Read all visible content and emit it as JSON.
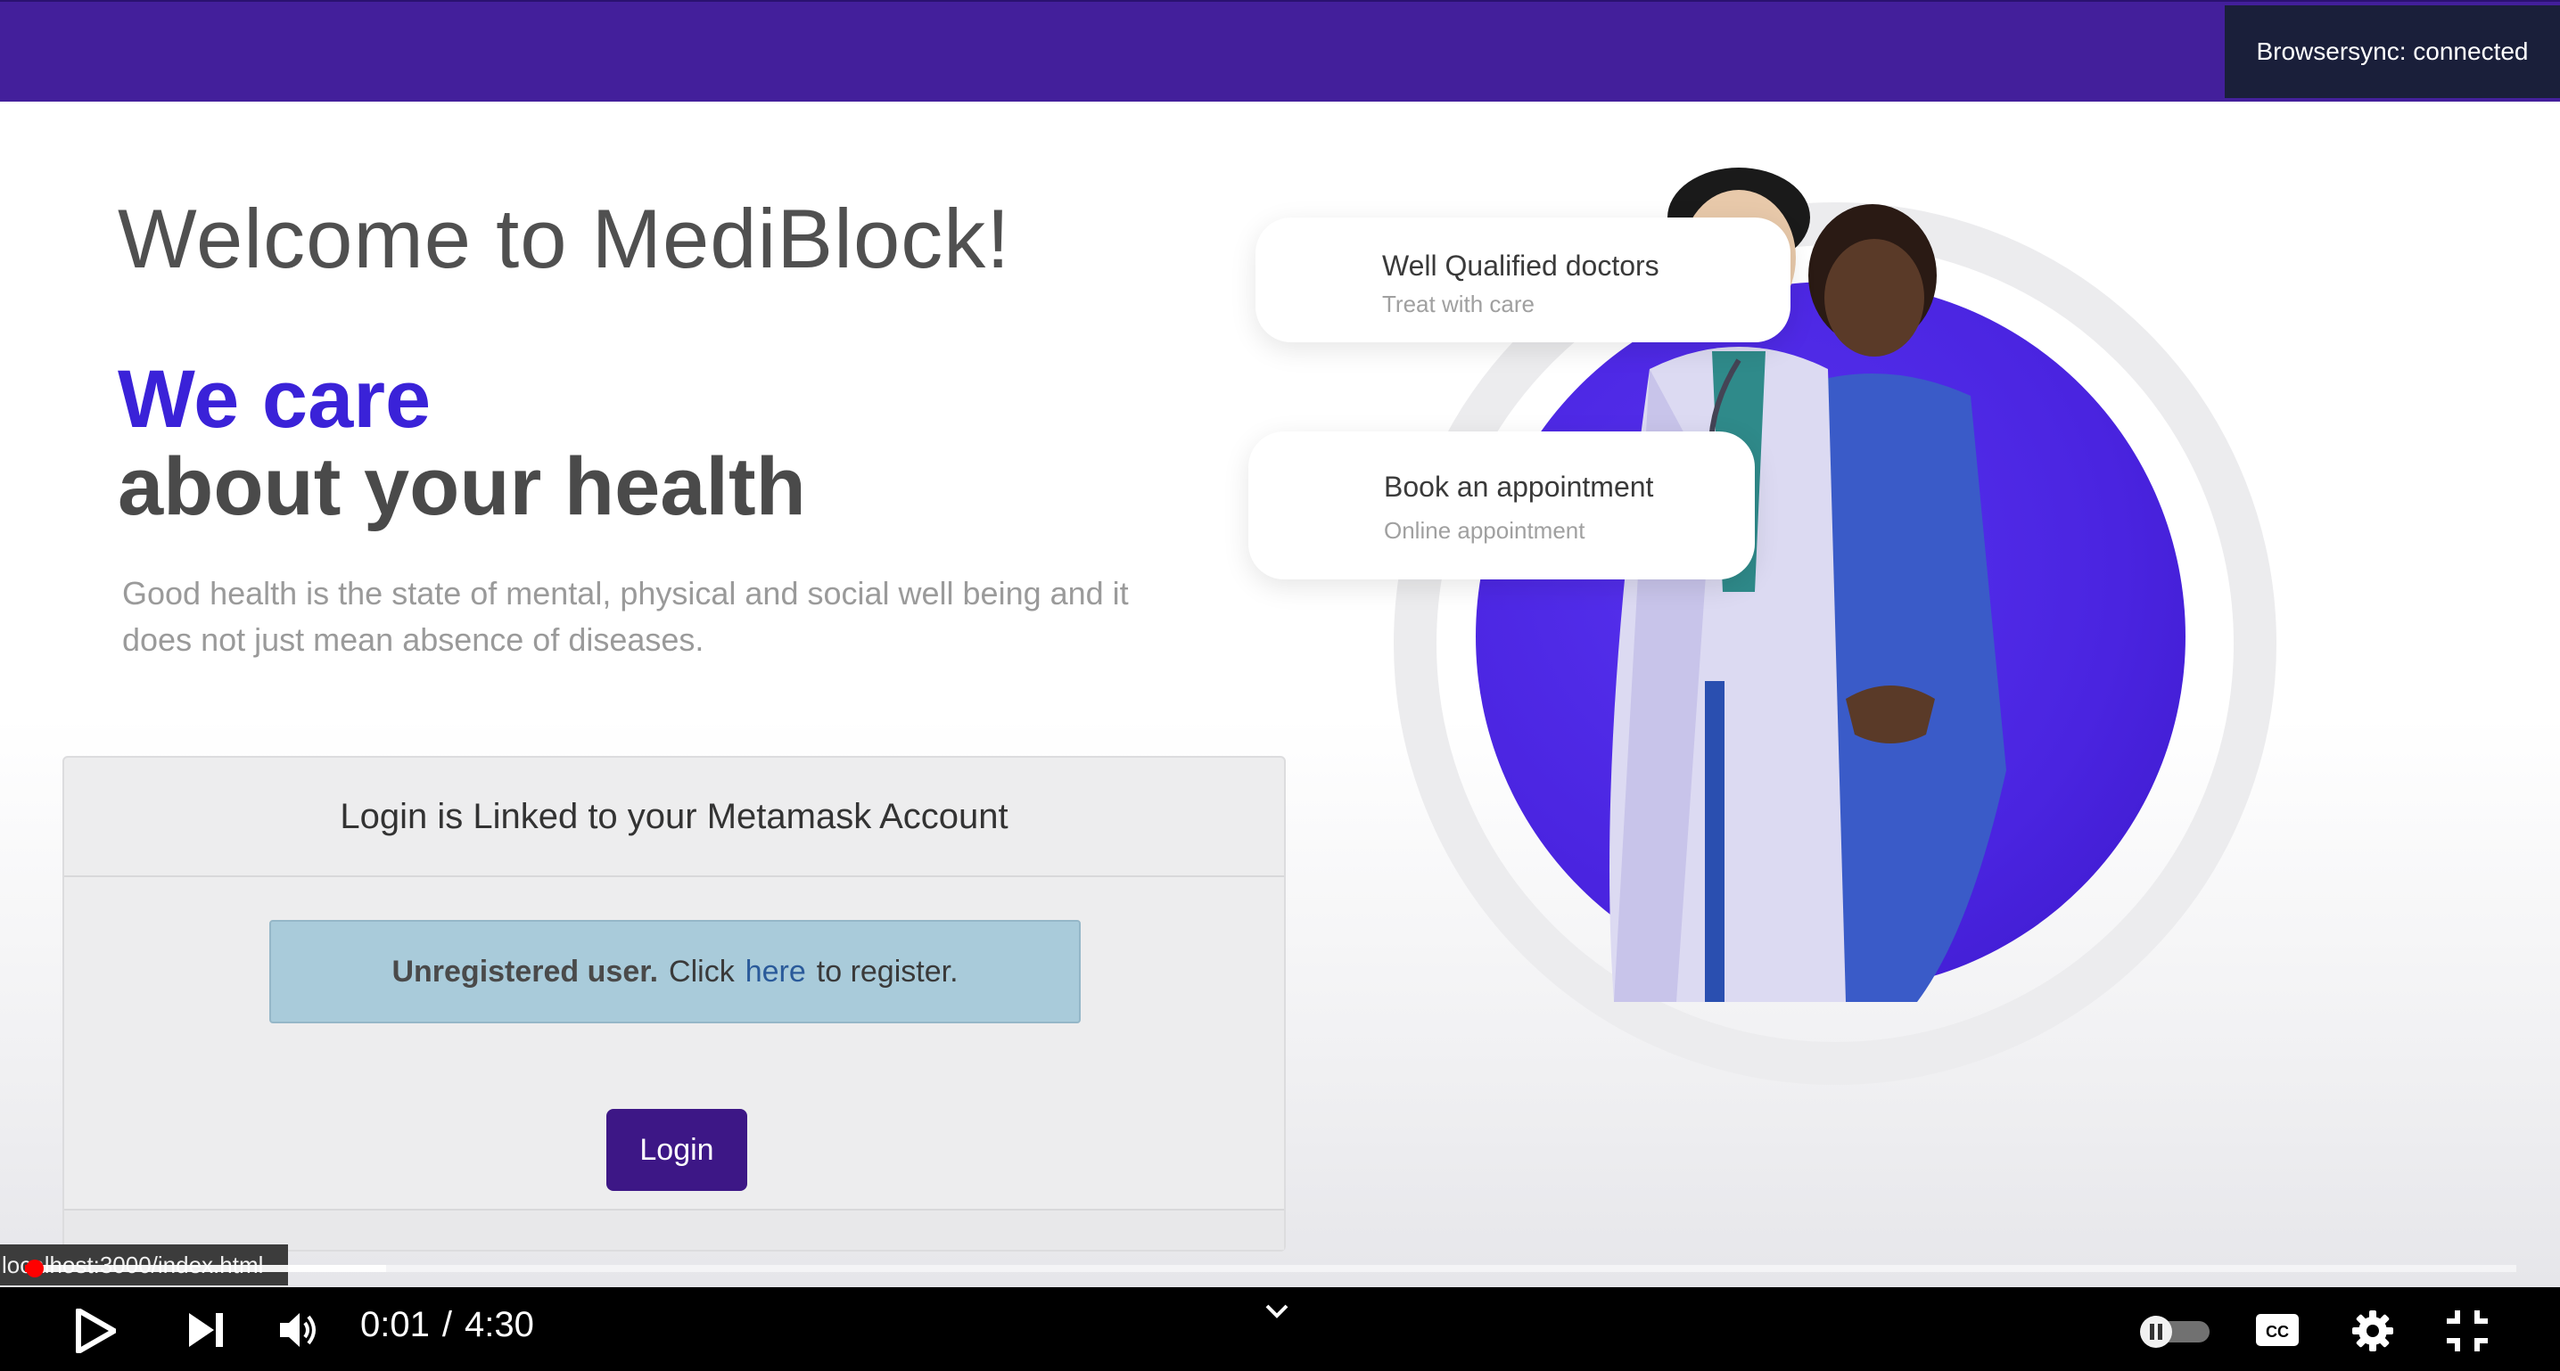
{
  "browsersync": {
    "text": "Browsersync: connected"
  },
  "hero": {
    "welcome": "Welcome to MediBlock!",
    "care_line": "We care",
    "health_line": "about your health",
    "description": "Good health is the state of mental, physical and social well being and it does not just mean absence of diseases."
  },
  "login": {
    "header": "Login is Linked to your Metamask Account",
    "alert_bold": "Unregistered user.",
    "alert_before": "Click",
    "alert_link": "here",
    "alert_after": "to register.",
    "button_label": "Login"
  },
  "cards": {
    "doctors_title": "Well Qualified doctors",
    "doctors_sub": "Treat with care",
    "appointment_title": "Book an appointment",
    "appointment_sub": "Online appointment"
  },
  "browser": {
    "status_url": "localhost:3000/index.html"
  },
  "player": {
    "current_time": "0:01",
    "separator": "/",
    "duration": "4:30",
    "played_fraction": 0.004,
    "buffered_fraction": 0.145,
    "icons": [
      "play-icon",
      "next-icon",
      "volume-icon",
      "chevron-down-icon",
      "autoplay-toggle-icon",
      "captions-icon",
      "settings-icon",
      "exit-fullscreen-icon"
    ]
  },
  "colors": {
    "top_bar": "#431f9b",
    "accent_purple": "#3a22d8",
    "login_button": "#3d1786",
    "alert_bg": "#a9cbda",
    "progress": "#ff0000"
  }
}
